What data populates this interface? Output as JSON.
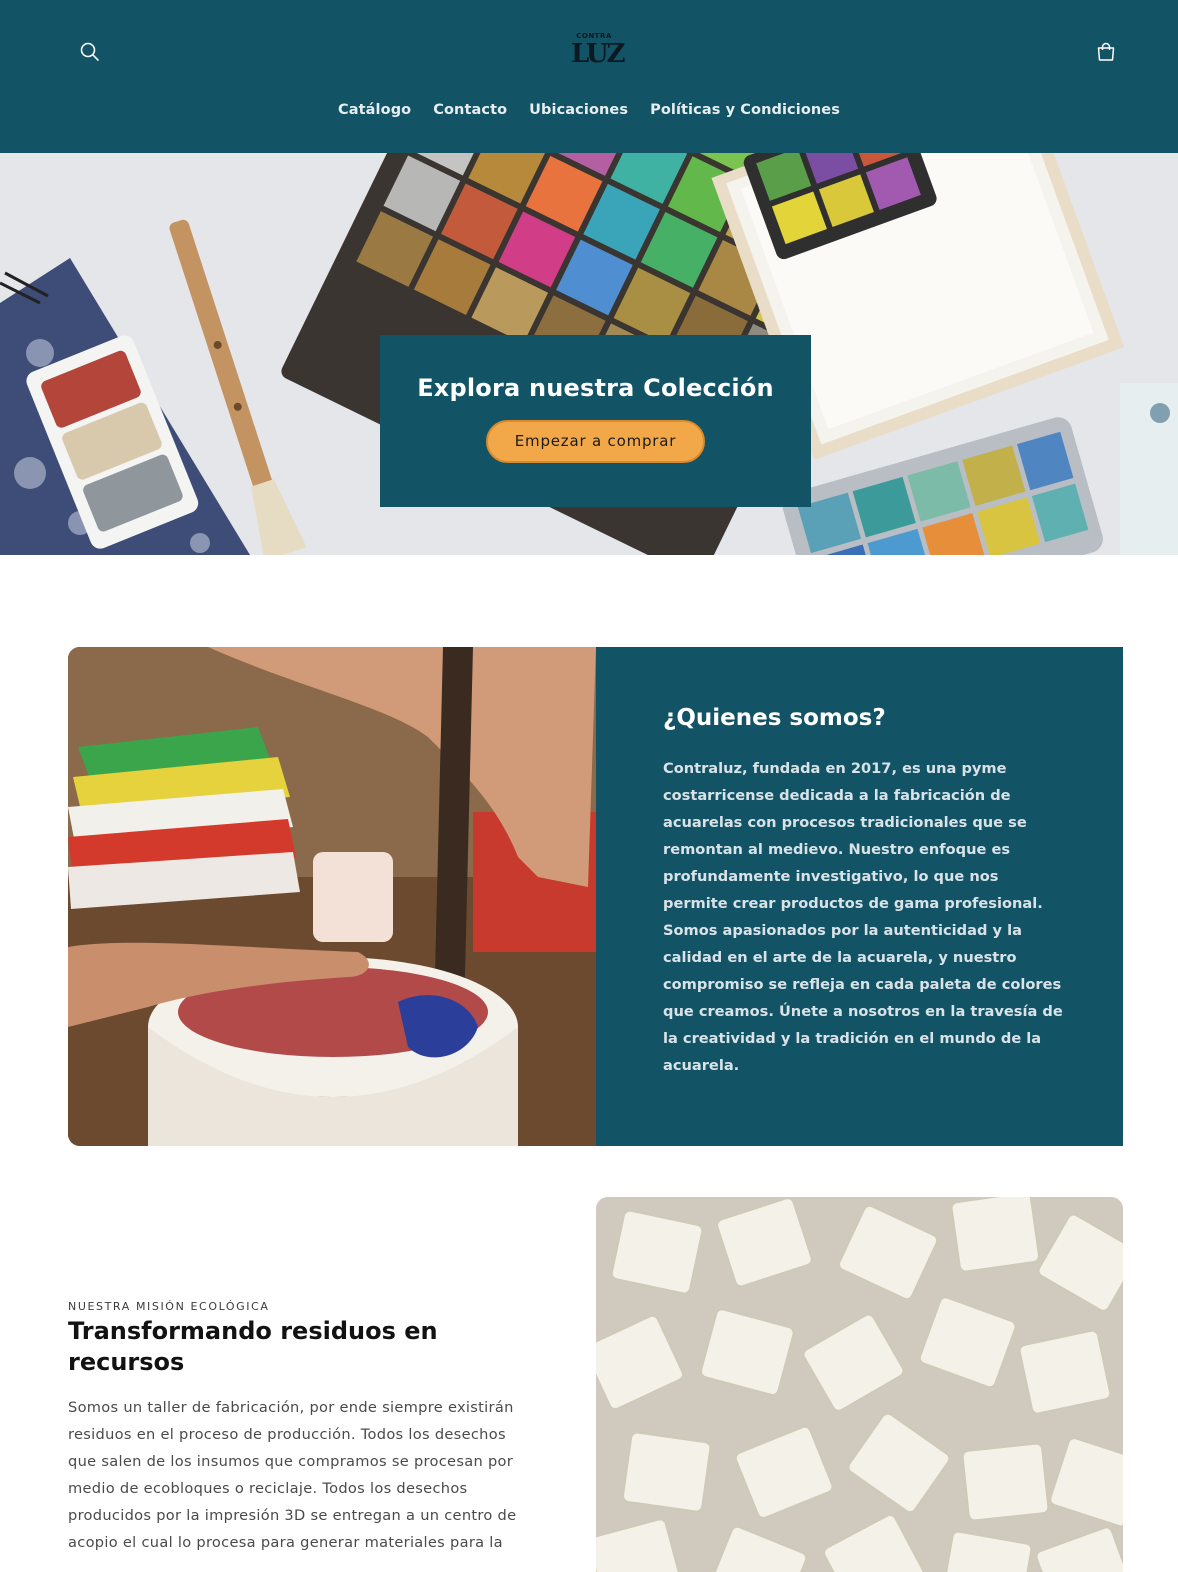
{
  "header": {
    "logo": {
      "top": "CONTRA",
      "main": "LUZ"
    },
    "search_icon": "search-icon",
    "cart_icon": "cart-icon",
    "nav": [
      {
        "label": "Catálogo"
      },
      {
        "label": "Contacto"
      },
      {
        "label": "Ubicaciones"
      },
      {
        "label": "Políticas y Condiciones"
      }
    ]
  },
  "hero": {
    "title": "Explora nuestra Colección",
    "button_label": "Empezar a comprar"
  },
  "about": {
    "title": "¿Quienes somos?",
    "text": "Contraluz, fundada en 2017, es una pyme costarricense dedicada a la fabricación de acuarelas con procesos tradicionales que se remontan al medievo. Nuestro enfoque es profundamente investigativo, lo que nos permite crear productos de gama profesional. Somos apasionados por la autenticidad y la calidad en el arte de la acuarela, y nuestro compromiso se refleja en cada paleta de colores que creamos. Únete a nosotros en la travesía de la creatividad y la tradición en el mundo de la acuarela."
  },
  "mission": {
    "eyebrow": "NUESTRA MISIÓN ECOLÓGICA",
    "title": "Transformando residuos en recursos",
    "text": "Somos un taller de fabricación, por ende siempre existirán residuos en el proceso de producción. Todos los desechos que salen de los insumos que compramos se procesan por medio de ecobloques o reciclaje. Todos los desechos producidos por la impresión 3D se entregan a un centro de acopio el cual lo procesa para generar materiales para la"
  },
  "colors": {
    "brand": "#125366",
    "accent": "#f2a748"
  }
}
